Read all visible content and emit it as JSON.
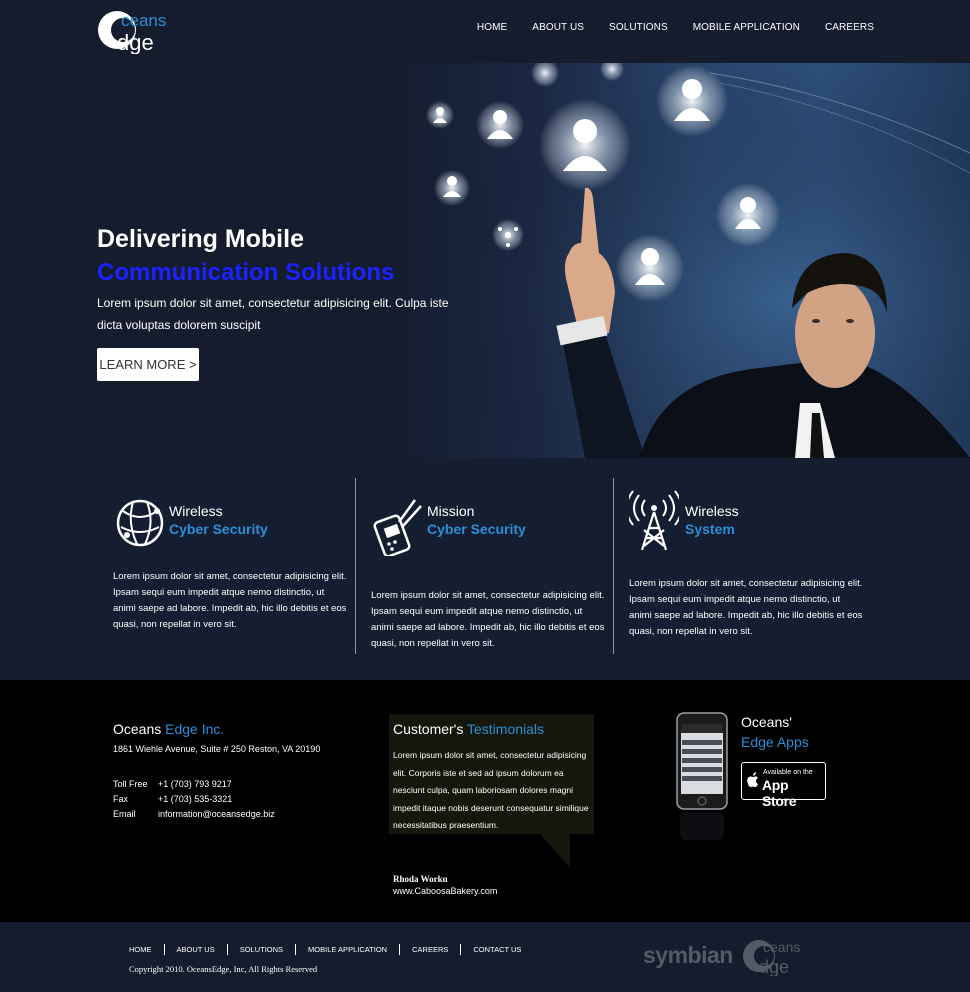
{
  "header": {
    "logo_text_top": "ceans",
    "logo_text_bottom": "dge",
    "nav": [
      "HOME",
      "ABOUT US",
      "SOLUTIONS",
      "MOBILE APPLICATION",
      "CAREERS"
    ]
  },
  "hero": {
    "title": "Delivering Mobile",
    "subtitle": "Communication Solutions",
    "text": "Lorem ipsum dolor sit amet, consectetur adipisicing elit. Culpa iste dicta voluptas dolorem suscipit",
    "button_label": "LEARN MORE >"
  },
  "features": [
    {
      "line1": "Wireless",
      "line2": "Cyber Security",
      "icon": "globe-icon",
      "text": "Lorem ipsum dolor sit amet, consectetur adipisicing elit. Ipsam sequi eum impedit atque nemo distinctio, ut animi saepe ad labore. Impedit ab, hic illo debitis et eos quasi, non repellat in vero sit."
    },
    {
      "line1": "Mission",
      "line2": "Cyber Security",
      "icon": "handheld-device-icon",
      "text": "Lorem ipsum dolor sit amet, consectetur adipisicing elit. Ipsam sequi eum impedit atque nemo distinctio, ut animi saepe ad labore. Impedit ab, hic illo debitis et eos quasi, non repellat in vero sit."
    },
    {
      "line1": "Wireless",
      "line2": "System",
      "icon": "antenna-tower-icon",
      "text": "Lorem ipsum dolor sit amet, consectetur adipisicing elit. Ipsam sequi eum impedit atque nemo distinctio, ut animi saepe ad labore. Impedit ab, hic illo debitis et eos quasi, non repellat in vero sit."
    }
  ],
  "company": {
    "name_part1": "Oceans",
    "name_part2": "Edge Inc.",
    "address": "1861 Wiehle Avenue, Suite # 250 Reston, VA 20190",
    "contacts": [
      {
        "label": "Toll Free",
        "value": "+1 (703) 793 9217"
      },
      {
        "label": "Fax",
        "value": "+1 (703) 535-3321"
      },
      {
        "label": "Email",
        "value": "information@oceansedge.biz"
      }
    ]
  },
  "testimonial": {
    "title_part1": "Customer's",
    "title_part2": "Testimonials",
    "text": "Lorem ipsum dolor sit amet, consectetur adipisicing elit. Corporis iste et sed ad ipsum dolorum ea nesciunt culpa, quam laboriosam dolores magni impedit itaque nobis deserunt consequatur similique necessitatibus praesentium.",
    "author": "Rhoda Worku",
    "site": "www.CaboosaBakery.com"
  },
  "apps": {
    "line1": "Oceans'",
    "line2": "Edge Apps",
    "badge_small": "Available on the",
    "badge_big": "App Store"
  },
  "bottom": {
    "nav": [
      "HOME",
      "ABOUT US",
      "SOLUTIONS",
      "MOBILE APPLICATION",
      "CAREERS",
      "CONTACT US"
    ],
    "copyright": "Copyright 2010. OceansEdge, Inc, All Rights Reserved",
    "symbian": "symbian",
    "logo_text_top": "ceans",
    "logo_text_bottom": "dge"
  },
  "colors": {
    "background": "#141c2e",
    "accent_blue": "#2a8fd6",
    "hero_subtitle": "#1a22ff",
    "footer_bg": "#000000"
  }
}
